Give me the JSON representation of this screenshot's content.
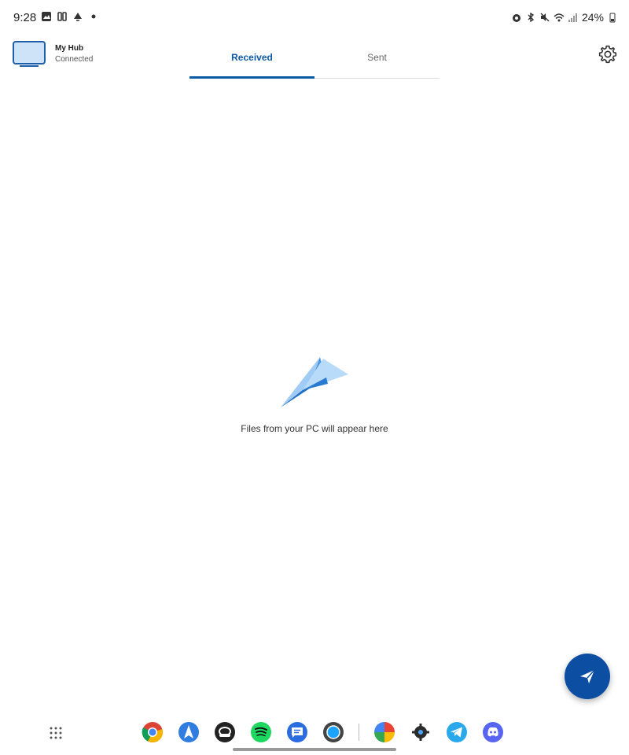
{
  "status_bar": {
    "time": "9:28",
    "battery": "24%"
  },
  "device": {
    "name": "My Hub",
    "status": "Connected"
  },
  "tabs": [
    {
      "label": "Received",
      "active": true
    },
    {
      "label": "Sent",
      "active": false
    }
  ],
  "empty_state": {
    "message": "Files from your PC will appear here"
  },
  "colors": {
    "accent": "#0b5aa8",
    "fab": "#0b4ea2",
    "plane_light": "#90c4f5",
    "plane_dark": "#1f6fc4"
  },
  "dock": {
    "apps": [
      "chrome-icon",
      "navigation-icon",
      "messenger-icon",
      "spotify-icon",
      "messages-icon",
      "camera-icon",
      "assistant-icon",
      "settings-icon",
      "telegram-icon",
      "discord-icon"
    ]
  }
}
